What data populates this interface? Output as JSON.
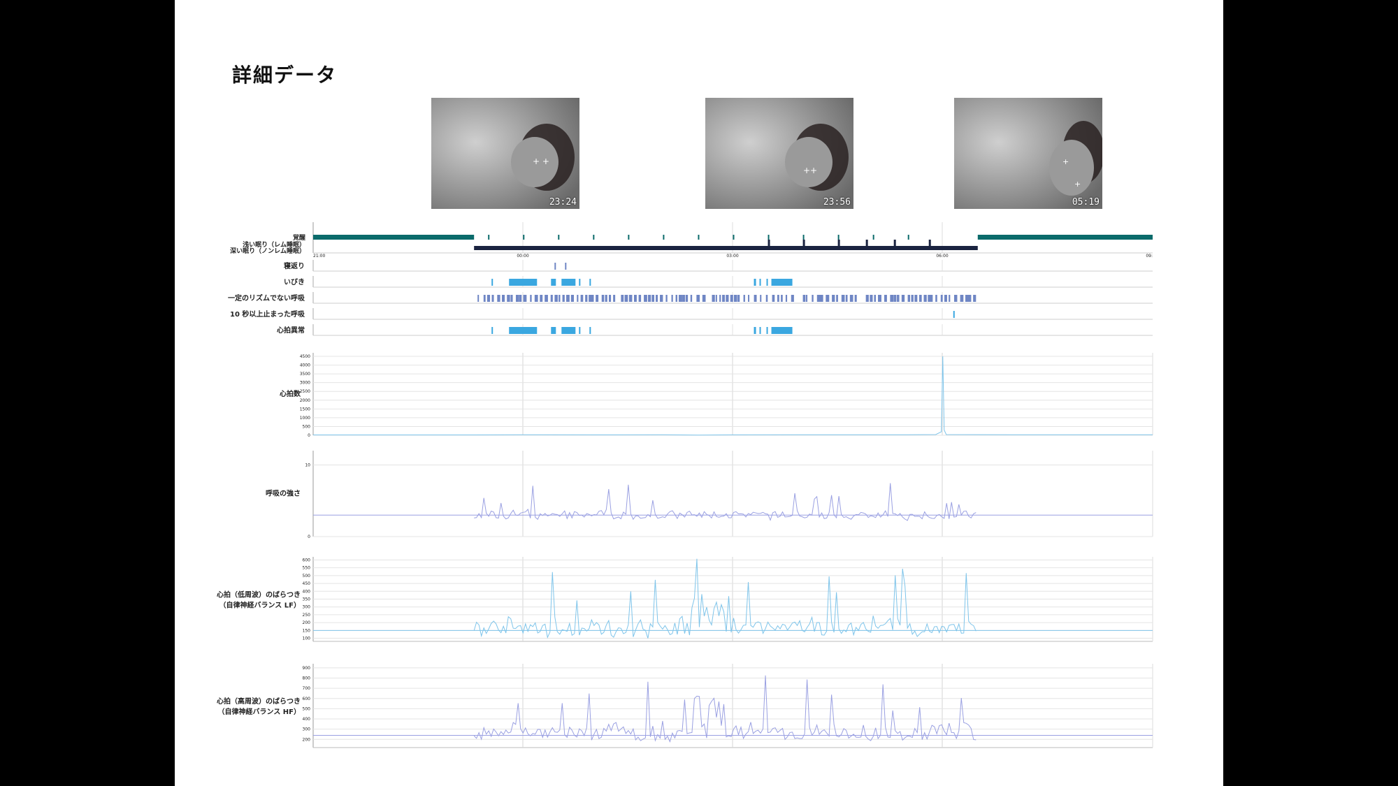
{
  "page": {
    "title": "詳細データ"
  },
  "thumbnails": [
    {
      "timestamp": "23:24",
      "icon": "camera-frame"
    },
    {
      "timestamp": "23:56",
      "icon": "camera-frame"
    },
    {
      "timestamp": "05:19",
      "icon": "camera-frame"
    }
  ],
  "colors": {
    "wake": "#0b6b6b",
    "sleep": "#1a2340",
    "event_light": "#3aa7e0",
    "event_purple": "#6f86c4",
    "line_light": "#7ec4ea",
    "line_purple": "#9aa0e2",
    "grid": "#cfcfcf"
  },
  "chart_data": {
    "type": "line",
    "x_ticks": [
      "21:00",
      "00:00",
      "03:00",
      "06:00",
      "09:"
    ],
    "hypnogram": {
      "labels": [
        "覚醒",
        "浅い眠り（レム睡眠）",
        "深い眠り（ノンレム睡眠）"
      ],
      "wake_periods": [
        [
          0,
          2.3
        ],
        [
          9.5,
          12
        ]
      ],
      "sleep_period": [
        2.3,
        9.5
      ],
      "wake_ticks": [
        2.5,
        3.0,
        3.5,
        4.0,
        4.5,
        5.0,
        5.5,
        6.0,
        6.5,
        7.0,
        7.5,
        8.0,
        8.5
      ]
    },
    "event_rows": [
      {
        "label": "寝返り",
        "color": "event_purple",
        "marks": [
          [
            3.45,
            3.47
          ],
          [
            3.6,
            3.62
          ]
        ]
      },
      {
        "label": "いびき",
        "color": "event_light",
        "marks": [
          [
            2.55,
            2.57
          ],
          [
            2.8,
            3.2
          ],
          [
            3.4,
            3.47
          ],
          [
            3.55,
            3.75
          ],
          [
            3.8,
            3.82
          ],
          [
            3.95,
            3.97
          ],
          [
            6.3,
            6.33
          ],
          [
            6.38,
            6.4
          ],
          [
            6.48,
            6.5
          ],
          [
            6.55,
            6.85
          ]
        ]
      },
      {
        "label": "一定のリズムでない呼吸",
        "color": "event_purple",
        "dense": [
          [
            2.35,
            3.05
          ],
          [
            3.1,
            4.3
          ],
          [
            4.4,
            5.6
          ],
          [
            5.7,
            6.9
          ],
          [
            7.0,
            7.8
          ],
          [
            7.9,
            9.5
          ]
        ]
      },
      {
        "label": "10 秒以上止まった呼吸",
        "color": "event_light",
        "marks": [
          [
            9.15,
            9.17
          ]
        ]
      },
      {
        "label": "心拍異常",
        "color": "event_light",
        "marks": [
          [
            2.55,
            2.57
          ],
          [
            2.8,
            3.2
          ],
          [
            3.4,
            3.47
          ],
          [
            3.55,
            3.75
          ],
          [
            3.8,
            3.82
          ],
          [
            3.95,
            3.97
          ],
          [
            6.3,
            6.33
          ],
          [
            6.38,
            6.4
          ],
          [
            6.48,
            6.5
          ],
          [
            6.55,
            6.85
          ]
        ]
      }
    ],
    "line_charts": [
      {
        "label": "心拍数",
        "color": "line_light",
        "yticks": [
          "0",
          "500",
          "1000",
          "1500",
          "2000",
          "2500",
          "3000",
          "3500",
          "4000",
          "4500"
        ],
        "ylim": [
          0,
          4700
        ],
        "points": [
          [
            0,
            20
          ],
          [
            2.3,
            20
          ],
          [
            3.0,
            30
          ],
          [
            4.0,
            25
          ],
          [
            5.0,
            30
          ],
          [
            5.5,
            10
          ],
          [
            6.0,
            25
          ],
          [
            7.0,
            30
          ],
          [
            8.5,
            30
          ],
          [
            8.9,
            40
          ],
          [
            8.98,
            200
          ],
          [
            9.0,
            4500
          ],
          [
            9.02,
            300
          ],
          [
            9.05,
            40
          ],
          [
            10,
            30
          ],
          [
            12,
            30
          ]
        ]
      },
      {
        "label": "呼吸の強さ",
        "color": "line_purple",
        "yticks": [
          "0",
          "10"
        ],
        "ylim": [
          0,
          12
        ]
      },
      {
        "label": "心拍（低周波）のばらつき",
        "label2": "（自律神経バランス LF）",
        "color": "line_light",
        "yticks": [
          "100",
          "150",
          "200",
          "250",
          "300",
          "350",
          "400",
          "450",
          "500",
          "550",
          "600"
        ],
        "ylim": [
          80,
          620
        ]
      },
      {
        "label": "心拍（高周波）のばらつき",
        "label2": "（自律神経バランス HF）",
        "color": "line_purple",
        "yticks": [
          "200",
          "300",
          "400",
          "500",
          "600",
          "700",
          "800",
          "900"
        ],
        "ylim": [
          120,
          940
        ]
      }
    ]
  }
}
